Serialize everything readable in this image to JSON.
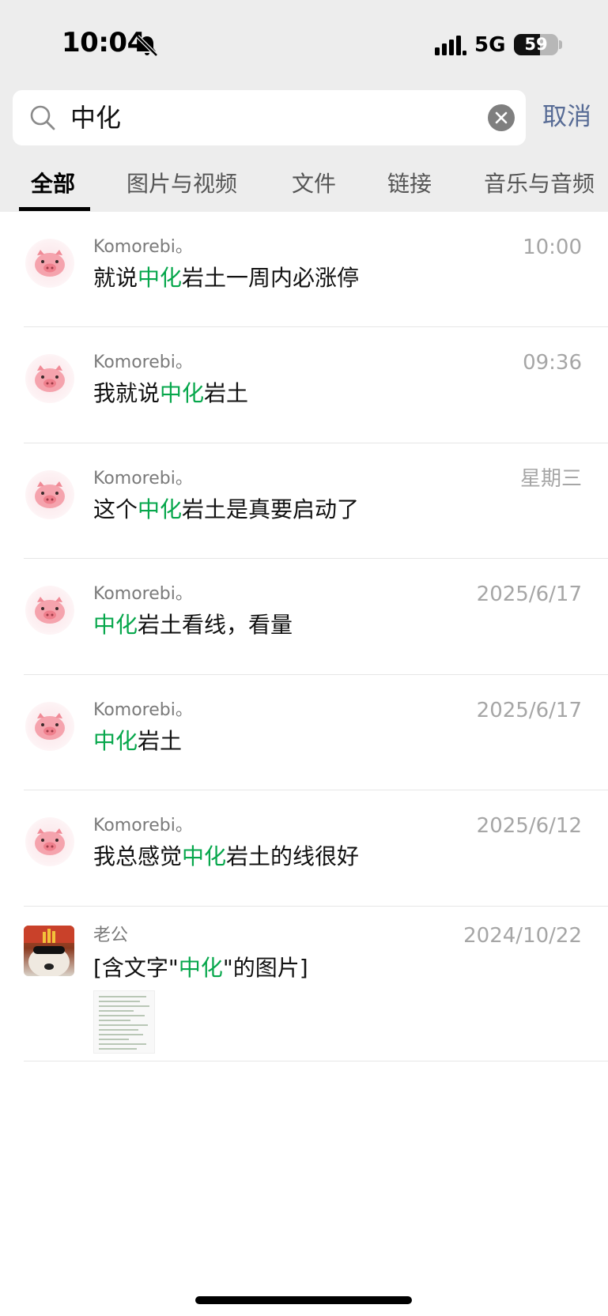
{
  "status_bar": {
    "time": "10:04",
    "network": "5G",
    "battery": "59",
    "battery_level_percent": 59,
    "icons": [
      "bell-slash-icon",
      "signal-bars-icon",
      "battery-icon"
    ]
  },
  "search": {
    "query": "中化",
    "cancel_label": "取消",
    "icons": [
      "search-icon",
      "clear-icon"
    ]
  },
  "tabs": [
    {
      "label": "全部",
      "active": true
    },
    {
      "label": "图片与视频",
      "active": false
    },
    {
      "label": "文件",
      "active": false
    },
    {
      "label": "链接",
      "active": false
    },
    {
      "label": "音乐与音频",
      "active": false
    }
  ],
  "results": [
    {
      "sender": "Komorebi。",
      "date": "10:00",
      "before": "就说",
      "highlight": "中化",
      "after": "岩土一周内必涨停",
      "avatar": "pig-icon"
    },
    {
      "sender": "Komorebi。",
      "date": "09:36",
      "before": "我就说",
      "highlight": "中化",
      "after": "岩土",
      "avatar": "pig-icon"
    },
    {
      "sender": "Komorebi。",
      "date": "星期三",
      "before": "这个",
      "highlight": "中化",
      "after": "岩土是真要启动了",
      "avatar": "pig-icon"
    },
    {
      "sender": "Komorebi。",
      "date": "2025/6/17",
      "before": "",
      "highlight": "中化",
      "after": "岩土看线，看量",
      "avatar": "pig-icon"
    },
    {
      "sender": "Komorebi。",
      "date": "2025/6/17",
      "before": "",
      "highlight": "中化",
      "after": "岩土",
      "avatar": "pig-icon"
    },
    {
      "sender": "Komorebi。",
      "date": "2025/6/12",
      "before": "我总感觉",
      "highlight": "中化",
      "after": "岩土的线很好",
      "avatar": "pig-icon"
    },
    {
      "sender": "老公",
      "date": "2024/10/22",
      "before": "[含文字\"",
      "highlight": "中化",
      "after": "\"的图片]",
      "avatar": "photo-avatar"
    }
  ],
  "colors": {
    "highlight": "#07a74c",
    "cancel_link": "#576b95",
    "header_bg": "#ededed"
  }
}
